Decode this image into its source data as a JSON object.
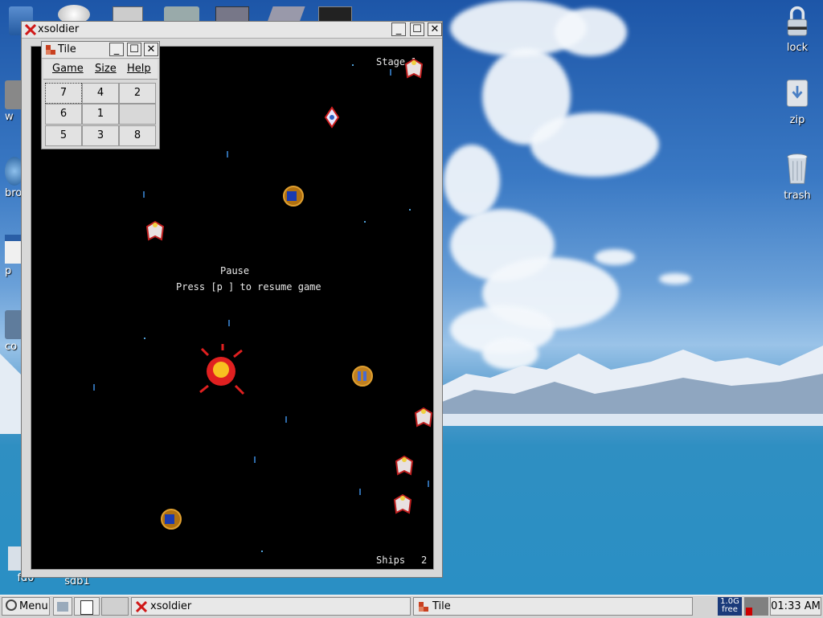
{
  "desktop": {
    "icons_left": [
      {
        "label": "w"
      },
      {
        "label": "bro"
      },
      {
        "label": "p"
      },
      {
        "label": "co"
      },
      {
        "label": "fd0"
      },
      {
        "label": "sdb1"
      }
    ],
    "icons_right": [
      {
        "label": "lock",
        "icon": "lock-icon"
      },
      {
        "label": "zip",
        "icon": "zip-drive-icon"
      },
      {
        "label": "trash",
        "icon": "trash-icon"
      }
    ]
  },
  "xsoldier": {
    "title": "xsoldier",
    "stage_label": "Stage 1",
    "pause_title": "Pause",
    "pause_hint": "Press [p ] to resume game",
    "ships_label": "Ships",
    "ships_count": "2",
    "powerup_text": "P",
    "powerup_sub": "ow"
  },
  "tile": {
    "title": "Tile",
    "menu": {
      "game": "Game",
      "size": "Size",
      "help": "Help"
    },
    "grid": [
      "7",
      "4",
      "2",
      "6",
      "1",
      "",
      "5",
      "3",
      "8"
    ]
  },
  "taskbar": {
    "menu_label": "Menu",
    "tasks": [
      {
        "label": "xsoldier"
      },
      {
        "label": "Tile"
      }
    ],
    "disk_free": "1.0G",
    "disk_free_sub": "free",
    "clock": "01:33 AM"
  }
}
